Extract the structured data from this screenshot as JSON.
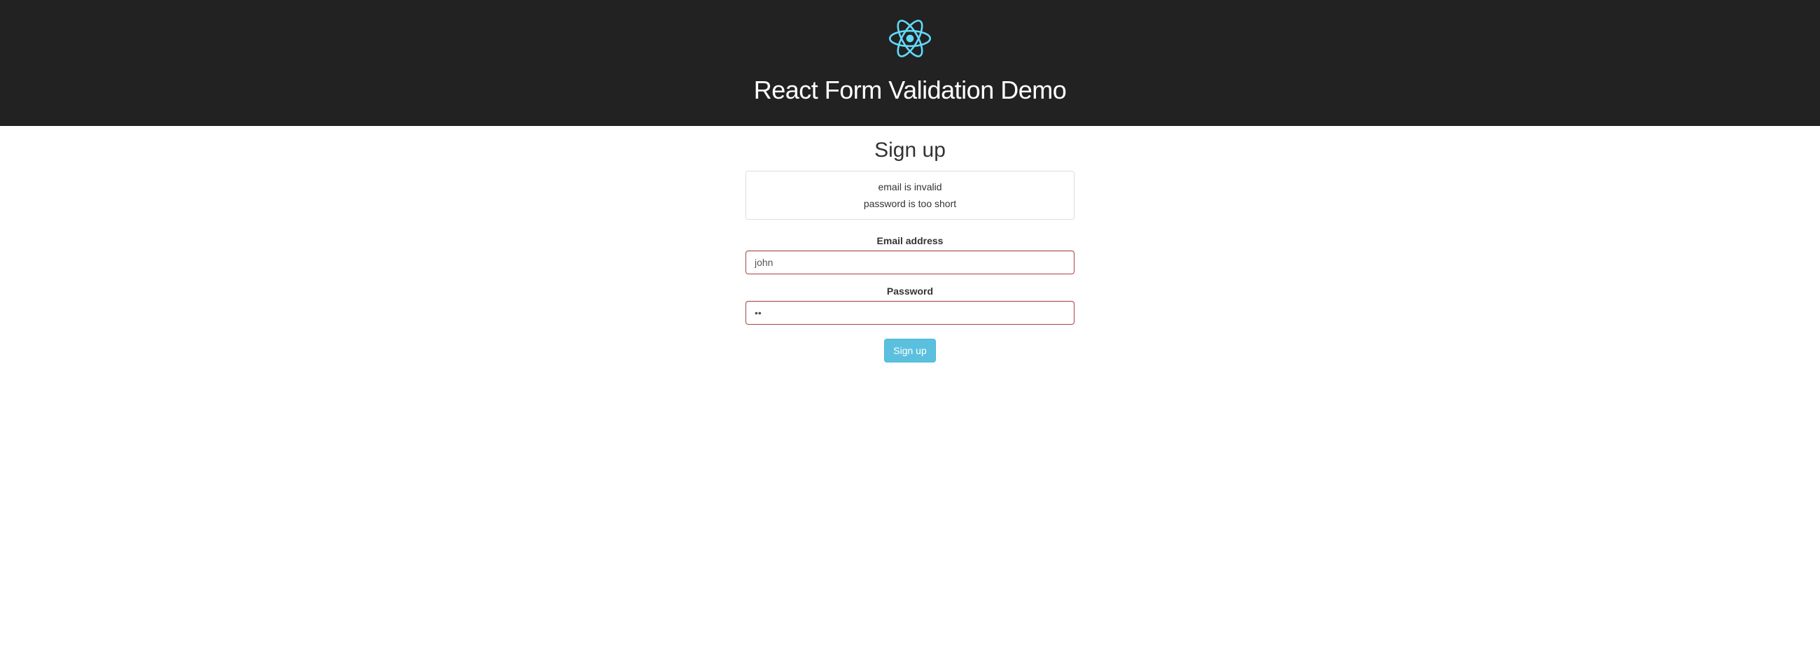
{
  "header": {
    "title": "React Form Validation Demo"
  },
  "form": {
    "title": "Sign up",
    "errors": [
      "email is invalid",
      "password is too short"
    ],
    "email": {
      "label": "Email address",
      "value": "john"
    },
    "password": {
      "label": "Password",
      "value": "••"
    },
    "submit_label": "Sign up"
  },
  "colors": {
    "header_bg": "#222",
    "react_logo": "#61dafb",
    "error_border": "#a94442",
    "button_bg": "#5bc0de"
  }
}
